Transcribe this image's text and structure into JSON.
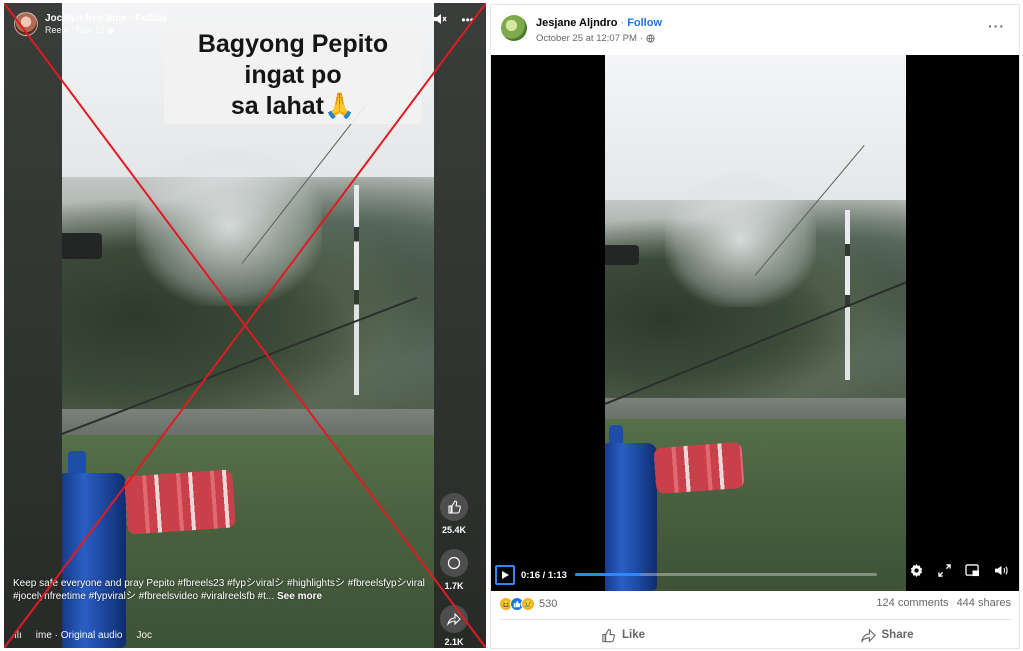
{
  "reel": {
    "author": "Jocelyn free time",
    "follow_label": "Follow",
    "source": "Reels",
    "date": "Nov 17",
    "caption_line1": "Bagyong Pepito  ingat po",
    "caption_line2": "sa lahat",
    "caption_emoji": "🙏",
    "like_count": "25.4K",
    "comment_count": "1.7K",
    "share_count": "2.1K",
    "description": "Keep safe everyone and pray Pepito #fbreels23 #fypシviralシ #highlightsシ #fbreelsfypシviral #jocelynfreetime #fypviralシ #fbreelsvideo #viralreelsfb #t...",
    "see_more": "See more",
    "audio_label": "ime · Original audio",
    "audio_author": "Joc"
  },
  "post": {
    "author": "Jesjane Aljndro",
    "follow_label": "Follow",
    "timestamp": "October 25 at 12:07 PM",
    "video_time": "0:16 / 1:13",
    "progress": 0.22,
    "reaction_count": "530",
    "comments": "124 comments",
    "shares": "444 shares",
    "like_label": "Like",
    "share_label": "Share"
  },
  "colors": {
    "fb_blue": "#1b74e4",
    "player_blue": "#2d88ff",
    "cross_red": "#e01b22",
    "muted_text": "#65676b"
  },
  "icons": [
    "profile-avatar",
    "globe-icon",
    "mute-icon",
    "more-icon",
    "thumbs-up-icon",
    "comment-icon",
    "share-icon",
    "audio-wave-icon",
    "play-icon",
    "settings-icon",
    "fullscreen-icon",
    "pip-icon",
    "volume-icon",
    "like-reaction",
    "love-reaction",
    "haha-reaction"
  ]
}
